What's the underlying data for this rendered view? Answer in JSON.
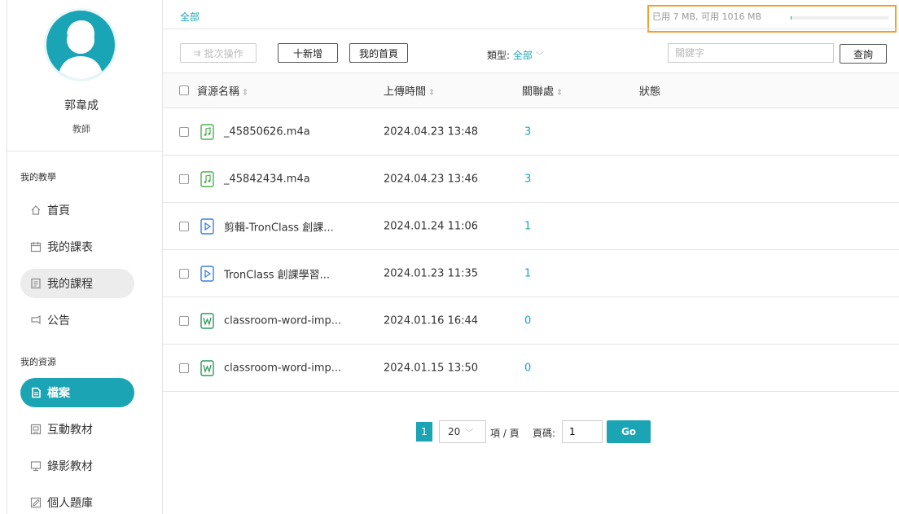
{
  "user": {
    "name": "郭韋成",
    "role": "教師"
  },
  "sidebar": {
    "section_teaching": "我的教學",
    "section_resources": "我的資源",
    "items": [
      {
        "label": "首頁",
        "icon": "home-icon"
      },
      {
        "label": "我的課表",
        "icon": "calendar-icon"
      },
      {
        "label": "我的課程",
        "icon": "course-icon"
      },
      {
        "label": "公告",
        "icon": "announcement-icon"
      },
      {
        "label": "檔案",
        "icon": "file-icon"
      },
      {
        "label": "互動教材",
        "icon": "interactive-material-icon"
      },
      {
        "label": "錄影教材",
        "icon": "video-material-icon"
      },
      {
        "label": "個人題庫",
        "icon": "question-bank-icon"
      }
    ]
  },
  "breadcrumb": "全部",
  "storage": {
    "text": "已用 7 MB, 可用 1016 MB",
    "used_fraction": 0.007
  },
  "toolbar": {
    "batch_label": "批次操作",
    "add_label": "十新增",
    "home_label": "我的首頁",
    "type_label": "類型: ",
    "type_value": "全部",
    "search_placeholder": "關鍵字",
    "search_button": "查詢"
  },
  "table": {
    "headers": {
      "name": "資源名稱",
      "uploaded": "上傳時間",
      "refs": "關聯處",
      "status": "狀態"
    },
    "rows": [
      {
        "name": "_45850626.m4a",
        "type": "audio",
        "uploaded": "2024.04.23 13:48",
        "refs": "3"
      },
      {
        "name": "_45842434.m4a",
        "type": "audio",
        "uploaded": "2024.04.23 13:46",
        "refs": "3"
      },
      {
        "name": "剪輯-TronClass 創課...",
        "type": "video",
        "uploaded": "2024.01.24 11:06",
        "refs": "1"
      },
      {
        "name": "TronClass 創課學習...",
        "type": "video",
        "uploaded": "2024.01.23 11:35",
        "refs": "1"
      },
      {
        "name": "classroom-word-imp...",
        "type": "word",
        "uploaded": "2024.01.16 16:44",
        "refs": "0"
      },
      {
        "name": "classroom-word-imp...",
        "type": "word",
        "uploaded": "2024.01.15 13:50",
        "refs": "0"
      }
    ]
  },
  "pager": {
    "current_page": "1",
    "page_size": "20",
    "per_page_label": "項 / 頁",
    "goto_label": "頁碼:",
    "goto_value": "1",
    "go_label": "Go"
  },
  "colors": {
    "accent": "#1ba4b4",
    "highlight_border": "#f0a030",
    "audio_icon": "#4caf50",
    "video_icon": "#3d7fdc",
    "word_icon": "#2e9a5a"
  }
}
